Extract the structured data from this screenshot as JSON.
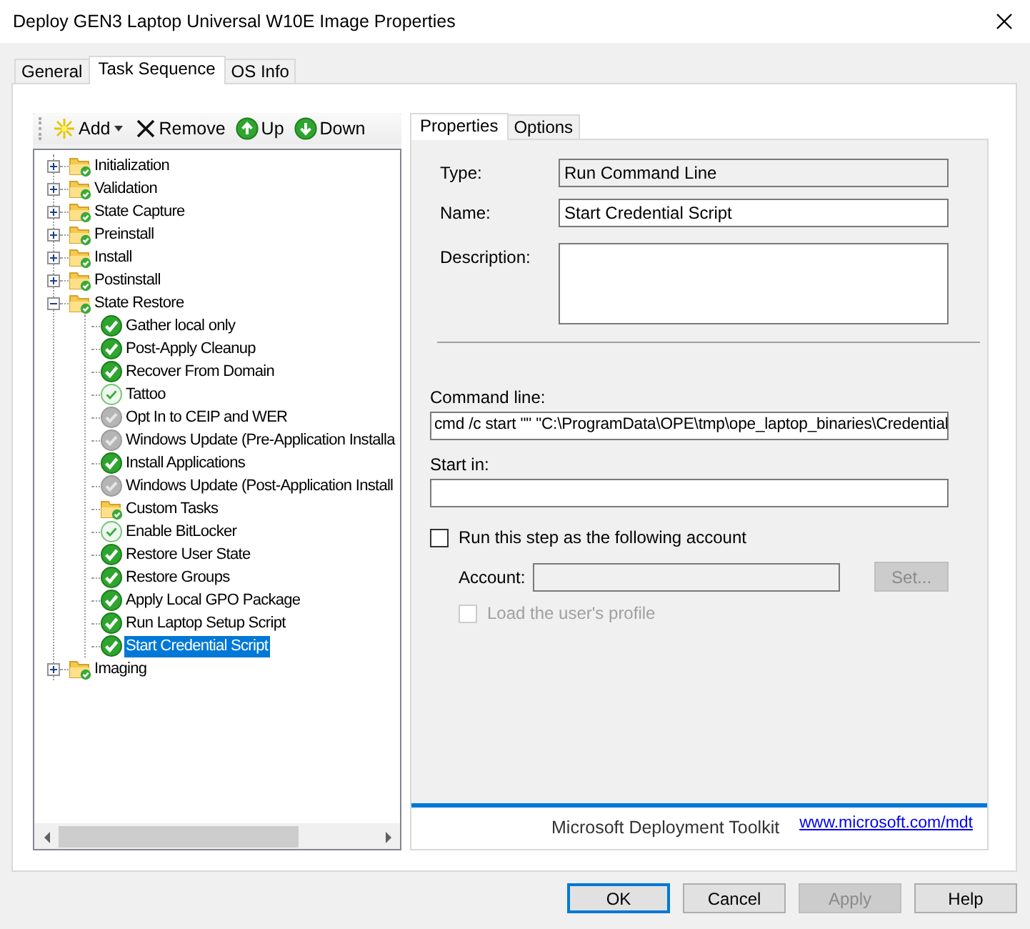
{
  "window": {
    "title": "Deploy GEN3 Laptop Universal W10E Image Properties"
  },
  "tabs": [
    {
      "label": "General",
      "selected": false
    },
    {
      "label": "Task Sequence",
      "selected": true
    },
    {
      "label": "OS Info",
      "selected": false
    }
  ],
  "toolbar": [
    {
      "kind": "add",
      "label": "Add",
      "has_menu": true
    },
    {
      "kind": "remove",
      "label": "Remove",
      "has_menu": false
    },
    {
      "kind": "up",
      "label": "Up",
      "has_menu": false
    },
    {
      "kind": "down",
      "label": "Down",
      "has_menu": false
    }
  ],
  "tree": [
    {
      "kind": "group",
      "label": "Initialization",
      "expanded": false,
      "selected": false,
      "disabled": false
    },
    {
      "kind": "group",
      "label": "Validation",
      "expanded": false,
      "selected": false,
      "disabled": false
    },
    {
      "kind": "group",
      "label": "State Capture",
      "expanded": false,
      "selected": false,
      "disabled": false
    },
    {
      "kind": "group",
      "label": "Preinstall",
      "expanded": false,
      "selected": false,
      "disabled": false
    },
    {
      "kind": "group",
      "label": "Install",
      "expanded": false,
      "selected": false,
      "disabled": false
    },
    {
      "kind": "group",
      "label": "Postinstall",
      "expanded": false,
      "selected": false,
      "disabled": false
    },
    {
      "kind": "group",
      "label": "State Restore",
      "expanded": true,
      "selected": false,
      "disabled": false,
      "children": [
        {
          "kind": "step",
          "label": "Gather local only",
          "selected": false,
          "disabled": false
        },
        {
          "kind": "step",
          "label": "Post-Apply Cleanup",
          "selected": false,
          "disabled": false
        },
        {
          "kind": "step",
          "label": "Recover From Domain",
          "selected": false,
          "disabled": false
        },
        {
          "kind": "step-light",
          "label": "Tattoo",
          "selected": false,
          "disabled": false
        },
        {
          "kind": "step",
          "label": "Opt In to CEIP and WER",
          "selected": false,
          "disabled": true
        },
        {
          "kind": "step",
          "label": "Windows Update (Pre-Application Installa",
          "selected": false,
          "disabled": true
        },
        {
          "kind": "step",
          "label": "Install Applications",
          "selected": false,
          "disabled": false
        },
        {
          "kind": "step",
          "label": "Windows Update (Post-Application Install",
          "selected": false,
          "disabled": true
        },
        {
          "kind": "group",
          "label": "Custom Tasks",
          "selected": false,
          "disabled": false
        },
        {
          "kind": "step-light",
          "label": "Enable BitLocker",
          "selected": false,
          "disabled": false
        },
        {
          "kind": "step",
          "label": "Restore User State",
          "selected": false,
          "disabled": false
        },
        {
          "kind": "step",
          "label": "Restore Groups",
          "selected": false,
          "disabled": false
        },
        {
          "kind": "step",
          "label": "Apply Local GPO Package",
          "selected": false,
          "disabled": false
        },
        {
          "kind": "step",
          "label": "Run Laptop Setup Script",
          "selected": false,
          "disabled": false
        },
        {
          "kind": "step",
          "label": "Start Credential Script",
          "selected": true,
          "disabled": false
        }
      ]
    },
    {
      "kind": "group",
      "label": "Imaging",
      "expanded": false,
      "selected": false,
      "disabled": false
    }
  ],
  "inner_tabs": [
    {
      "label": "Properties",
      "selected": true
    },
    {
      "label": "Options",
      "selected": false
    }
  ],
  "properties": {
    "type": {
      "label": "Type:",
      "value": "Run Command Line"
    },
    "name": {
      "label": "Name:",
      "value": "Start Credential Script"
    },
    "description": {
      "label": "Description:"
    },
    "command_line": {
      "label": "Command line:",
      "value": "cmd /c start \"\" \"C:\\ProgramData\\OPE\\tmp\\ope_laptop_binaries\\Credential"
    },
    "start_in": {
      "label": "Start in:"
    },
    "run_as": {
      "label": "Run this step as the following account",
      "checked": false
    },
    "account": {
      "label": "Account:",
      "disabled": true
    },
    "set_button": {
      "label": "Set...",
      "disabled": true
    },
    "load_profile": {
      "label": "Load the user's profile",
      "checked": false,
      "disabled": true
    }
  },
  "footer": {
    "product": "Microsoft Deployment Toolkit",
    "link": "www.microsoft.com/mdt"
  },
  "buttons": [
    {
      "label": "OK",
      "default": true,
      "disabled": false
    },
    {
      "label": "Cancel",
      "default": false,
      "disabled": false
    },
    {
      "label": "Apply",
      "default": false,
      "disabled": true
    },
    {
      "label": "Help",
      "default": false,
      "disabled": false
    }
  ]
}
